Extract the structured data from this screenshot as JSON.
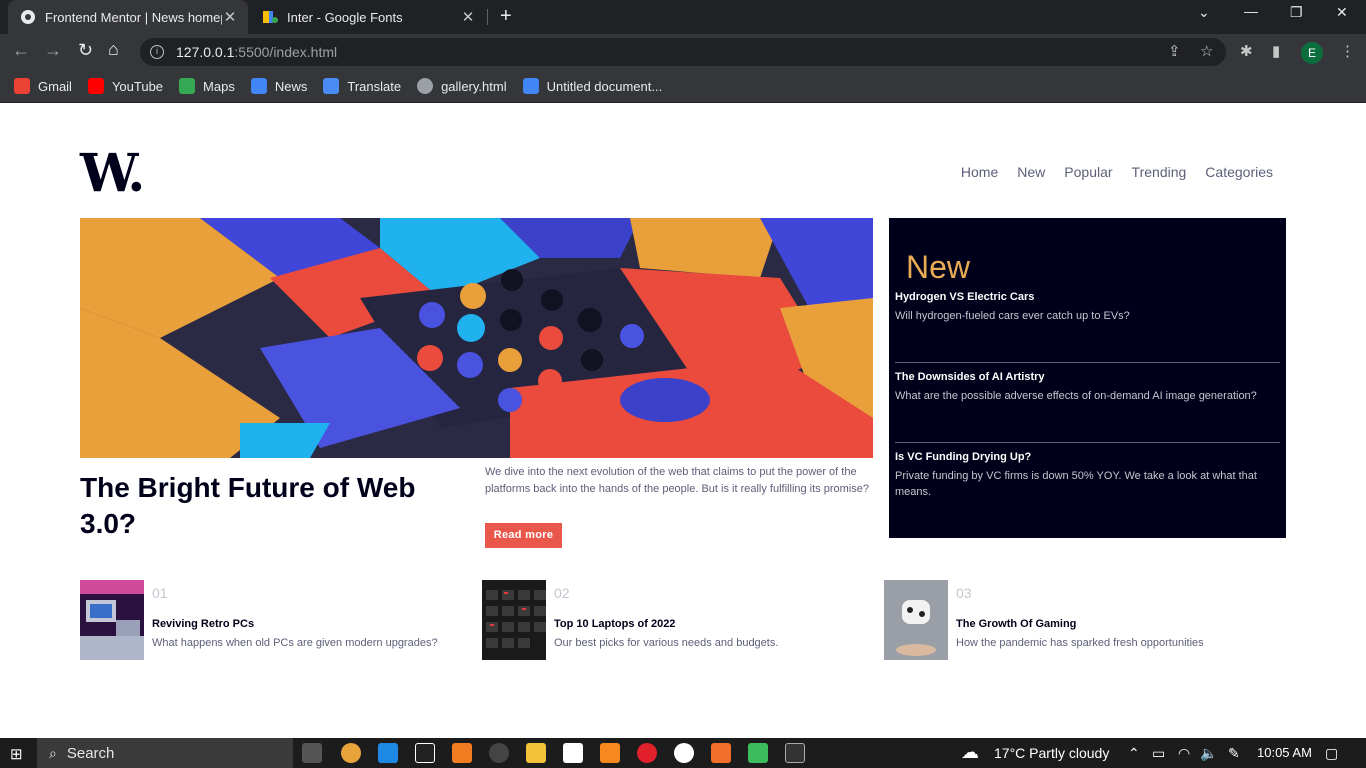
{
  "browser": {
    "tabs": [
      {
        "title": "Frontend Mentor | News homepage",
        "active": true
      },
      {
        "title": "Inter - Google Fonts",
        "active": false
      }
    ],
    "new_tab": "+",
    "url_host": "127.0.0.1",
    "url_path": ":5500/index.html",
    "profile_initial": "E",
    "bookmarks": [
      "Gmail",
      "YouTube",
      "Maps",
      "News",
      "Translate",
      "gallery.html",
      "Untitled document..."
    ]
  },
  "site": {
    "logo": "W.",
    "nav": [
      "Home",
      "New",
      "Popular",
      "Trending",
      "Categories"
    ],
    "headline": "The Bright Future of Web 3.0?",
    "lede": "We dive into the next evolution of the web that claims to put the power of the platforms back into the hands of the people. But is it really fulfilling its promise?",
    "read_more": "Read more",
    "new_section": {
      "title": "New",
      "items": [
        {
          "title": "Hydrogen VS Electric Cars",
          "desc": "Will hydrogen-fueled cars ever catch up to EVs?"
        },
        {
          "title": "The Downsides of AI Artistry",
          "desc": "What are the possible adverse effects of on-demand AI image generation?"
        },
        {
          "title": "Is VC Funding Drying Up?",
          "desc": "Private funding by VC firms is down 50% YOY. We take a look at what that means."
        }
      ]
    },
    "cards": [
      {
        "num": "01",
        "title": "Reviving Retro PCs",
        "desc": "What happens when old PCs are given modern upgrades?"
      },
      {
        "num": "02",
        "title": "Top 10 Laptops of 2022",
        "desc": "Our best picks for various needs and budgets."
      },
      {
        "num": "03",
        "title": "The Growth Of Gaming",
        "desc": "How the pandemic has sparked fresh opportunities"
      }
    ],
    "colors": {
      "accent": "#e9574a",
      "new_title": "#e9ab53",
      "dark": "#00001a",
      "muted": "#5d5f79"
    }
  },
  "taskbar": {
    "search": "Search",
    "weather": "17°C  Partly cloudy",
    "time": "10:05 AM"
  }
}
